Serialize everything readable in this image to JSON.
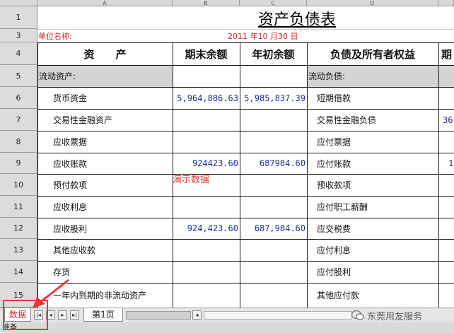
{
  "columns": [
    "A",
    "B",
    "C",
    "D"
  ],
  "rows": [
    "1",
    "3",
    "4",
    "5",
    "6",
    "7",
    "8",
    "9",
    "10",
    "11",
    "12",
    "13",
    "14",
    "15"
  ],
  "title": "资产负债表",
  "unit_label": "单位名称:",
  "date_text": "2011 年10 月30 日",
  "headers": {
    "assets": "资　　产",
    "end_balance": "期末余额",
    "begin_balance": "年初余额",
    "liabilities": "负债及所有者权益",
    "end_balance_cut": "期"
  },
  "sections": {
    "current_assets": "流动资产:",
    "current_liabilities": "流动负债:"
  },
  "asset_items": [
    "货币资金",
    "交易性金融资产",
    "应收票据",
    "应收账款",
    "预付款项",
    "应收利息",
    "应收股利",
    "其他应收款",
    "存货",
    "一年内到期的非流动资产"
  ],
  "liability_items": [
    "短期借款",
    "交易性金融负债",
    "应付票据",
    "应付账款",
    "预收款项",
    "应付职工薪酬",
    "应交税费",
    "应付利息",
    "应付股利",
    "其他应付款"
  ],
  "values": {
    "cash_end": "5,964,886.63",
    "cash_begin": "5,985,837.39",
    "ar_end": "924423.60",
    "ar_begin": "687984.60",
    "div_end": "924,423.60",
    "div_begin": "687,984.60",
    "cut_e7": "36",
    "cut_e9": "1"
  },
  "annotation": "演示数据",
  "tabs": {
    "active": "数据",
    "page1": "第1页"
  },
  "status": "准备",
  "watermark": "东莞用友服务"
}
